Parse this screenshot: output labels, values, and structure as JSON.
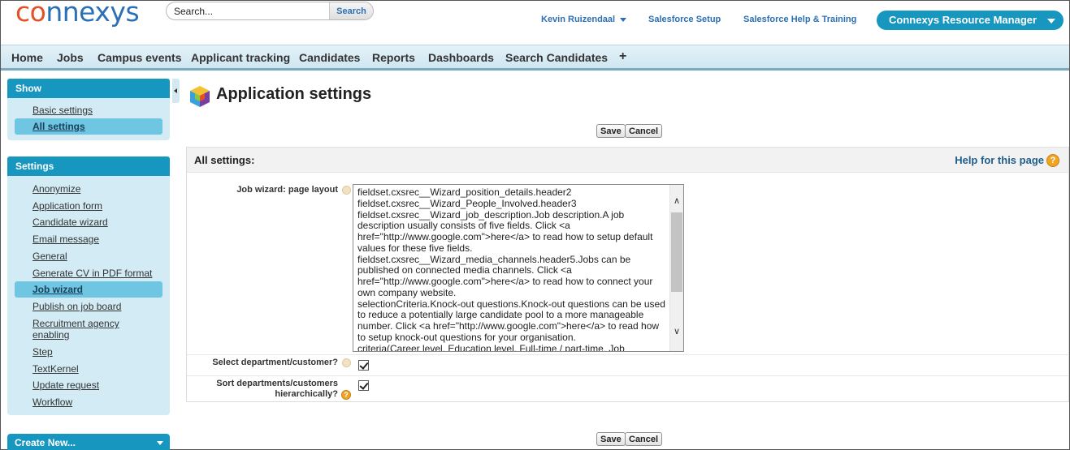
{
  "header": {
    "logo": {
      "part1": "co",
      "part2": "nnexys"
    },
    "search": {
      "placeholder": "Search...",
      "button_label": "Search"
    },
    "user_menu": "Kevin Ruizendaal",
    "setup_link": "Salesforce Setup",
    "help_link": "Salesforce Help & Training",
    "app_menu": "Connexys Resource Manager"
  },
  "tabs": [
    "Home",
    "Jobs",
    "Campus events",
    "Applicant tracking",
    "Candidates",
    "Reports",
    "Dashboards",
    "Search Candidates"
  ],
  "tab_add_label": "+",
  "sidebar": {
    "show_title": "Show",
    "show_items": [
      {
        "label": "Basic settings",
        "selected": false
      },
      {
        "label": "All settings",
        "selected": true
      }
    ],
    "settings_title": "Settings",
    "settings_items": [
      {
        "label": "Anonymize",
        "selected": false
      },
      {
        "label": "Application form",
        "selected": false
      },
      {
        "label": "Candidate wizard",
        "selected": false
      },
      {
        "label": "Email message",
        "selected": false
      },
      {
        "label": "General",
        "selected": false
      },
      {
        "label": "Generate CV in PDF format",
        "selected": false
      },
      {
        "label": "Job wizard",
        "selected": true
      },
      {
        "label": "Publish on job board",
        "selected": false
      },
      {
        "label": "Recruitment agency enabling",
        "selected": false
      },
      {
        "label": "Step",
        "selected": false
      },
      {
        "label": "TextKernel",
        "selected": false
      },
      {
        "label": "Update request",
        "selected": false
      },
      {
        "label": "Workflow",
        "selected": false
      }
    ],
    "create_new": "Create New..."
  },
  "main": {
    "title": "Application settings",
    "save_label": "Save",
    "cancel_label": "Cancel",
    "section_title": "All settings:",
    "help_label": "Help for this page",
    "fields": {
      "job_wizard_label": "Job wizard: page layout",
      "job_wizard_value": "fieldset.cxsrec__Wizard_position_details.header2\nfieldset.cxsrec__Wizard_People_Involved.header3\nfieldset.cxsrec__Wizard_job_description.Job description.A job description usually consists of five fields. Click <a href=\"http://www.google.com\">here</a> to read how to setup default values for these five fields.\nfieldset.cxsrec__Wizard_media_channels.header5.Jobs can be published on connected media channels. Click <a href=\"http://www.google.com\">here</a> to read how to connect your own company website.\nselectionCriteria.Knock-out questions.Knock-out questions can be used to reduce a potentially large candidate pool to a more manageable number. Click <a href=\"http://www.google.com\">here</a> to read how to setup knock-out questions for your organisation.\ncriteria(Career level, Education level, Full-time / part-time, Job",
      "select_department_label": "Select department/customer?",
      "select_department_checked": true,
      "sort_departments_label": "Sort departments/customers hierarchically?",
      "sort_departments_checked": true
    }
  },
  "colors": {
    "accent": "#1797c0",
    "selected": "#6ec6e3",
    "sidebar_bg": "#d3ebf4",
    "logo_orange": "#e2522a",
    "logo_blue": "#2b6fb4",
    "help_icon": "#f0a520"
  },
  "icons": {
    "page_icon": "cube-icon",
    "help_icon": "question-icon",
    "scroll_up": "chevron-up-icon",
    "scroll_down": "chevron-down-icon"
  }
}
